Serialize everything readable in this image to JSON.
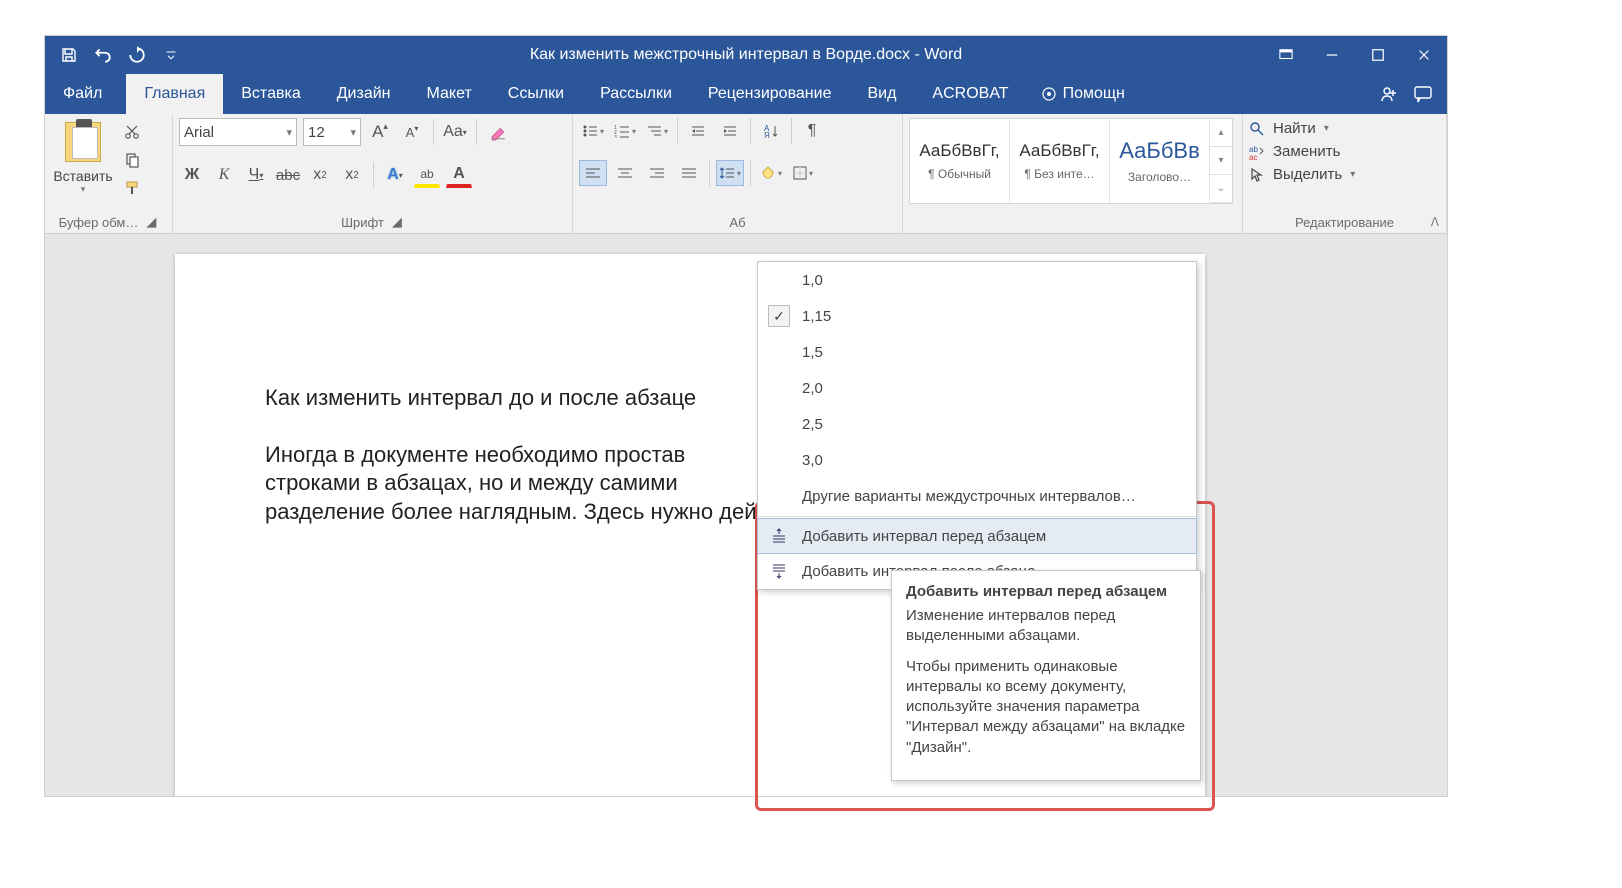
{
  "titlebar": {
    "document_title": "Как изменить межстрочный интервал в Ворде.docx - Word"
  },
  "tabs": {
    "file": "Файл",
    "home": "Главная",
    "insert": "Вставка",
    "design": "Дизайн",
    "layout": "Макет",
    "references": "Ссылки",
    "mailings": "Рассылки",
    "review": "Рецензирование",
    "view": "Вид",
    "acrobat": "ACROBAT",
    "tell_me": "Помощн"
  },
  "ribbon": {
    "clipboard": {
      "paste": "Вставить",
      "group_label": "Буфер обм…"
    },
    "font": {
      "name": "Arial",
      "size": "12",
      "group_label": "Шрифт",
      "increase_label": "A",
      "decrease_label": "A",
      "case_label": "Aa",
      "bold": "Ж",
      "italic": "К",
      "underline": "Ч",
      "strike": "abc",
      "sub": "x₂",
      "sup": "x²",
      "effects": "A",
      "highlight": "ab",
      "color": "A"
    },
    "paragraph": {
      "group_label": "Аб"
    },
    "styles": {
      "sample": "АаБбВвГг,",
      "sample_h1": "АаБбВв",
      "normal": "¶ Обычный",
      "no_spacing": "¶ Без инте…",
      "heading1": "Заголово…"
    },
    "editing": {
      "find": "Найти",
      "replace": "Заменить",
      "select": "Выделить",
      "group_label": "Редактирование"
    }
  },
  "line_spacing_menu": {
    "options": [
      "1,0",
      "1,15",
      "1,5",
      "2,0",
      "2,5",
      "3,0"
    ],
    "selected_index": 1,
    "more": "Другие варианты междустрочных интервалов…",
    "add_before": "Добавить интервал перед абзацем",
    "add_after": "Добавить интервал после абзаца"
  },
  "tooltip": {
    "title": "Добавить интервал перед абзацем",
    "desc1": "Изменение интервалов перед выделенными абзацами.",
    "desc2": "Чтобы применить одинаковые интервалы ко всему документу, используйте значения параметра \"Интервал между абзацами\" на вкладке \"Дизайн\"."
  },
  "document": {
    "heading": "Как изменить интервал до и после абзаце",
    "body_line1": "Иногда в документе необходимо простав",
    "body_line2": "строками в абзацах, но и между самими ",
    "body_line3": "разделение более наглядным. Здесь нужно действов"
  }
}
